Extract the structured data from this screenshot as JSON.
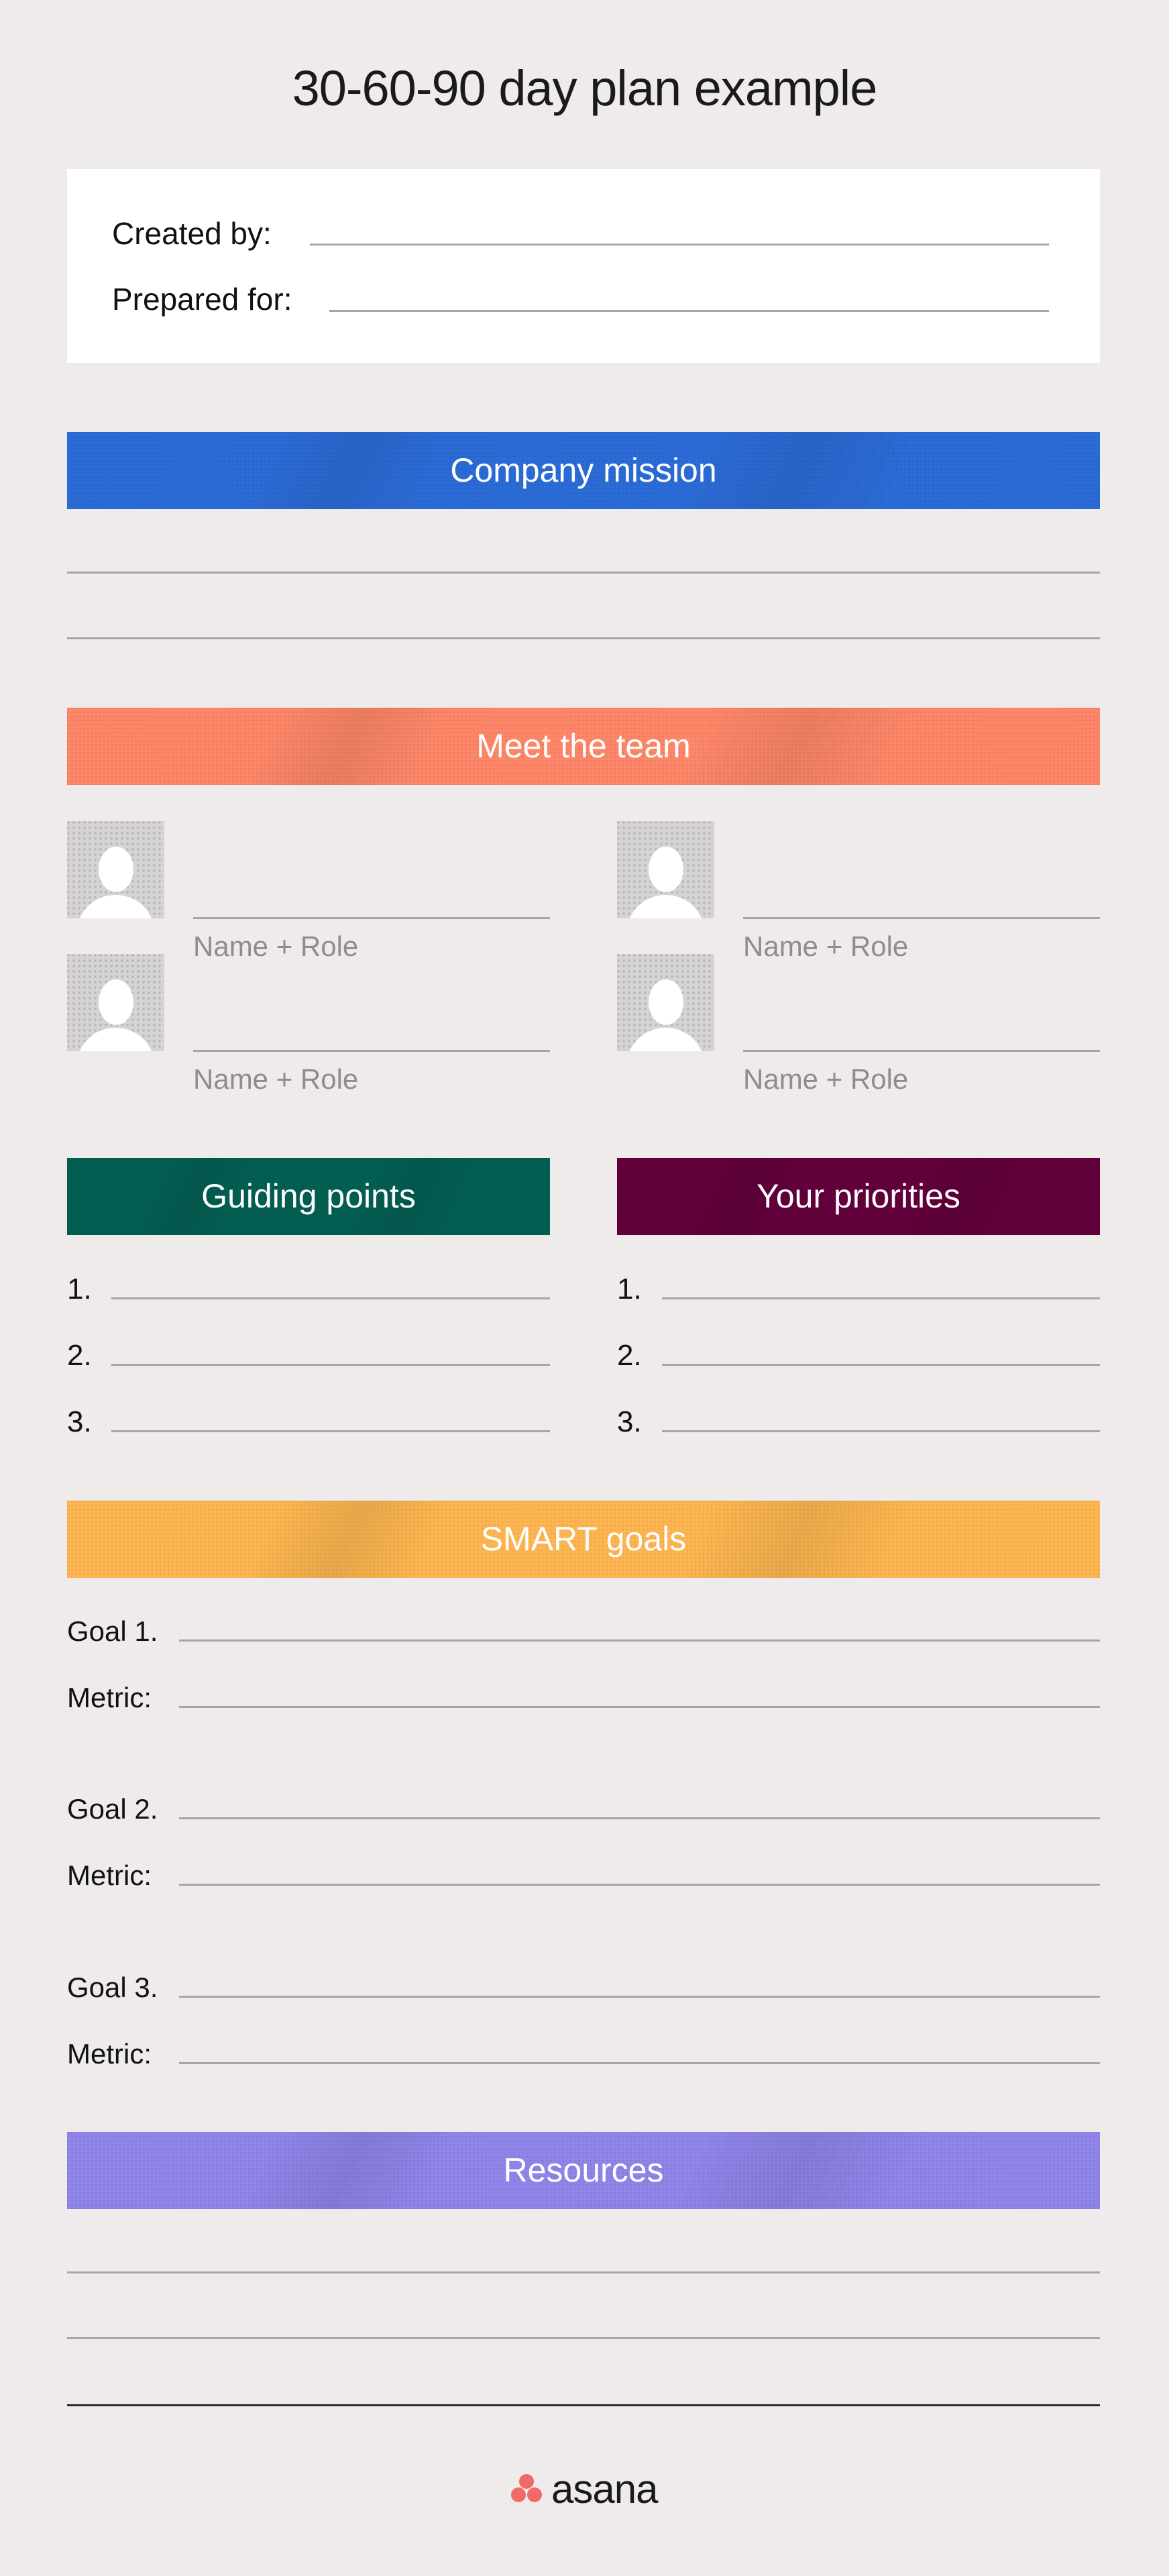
{
  "title": "30-60-90 day plan example",
  "header_card": {
    "created_by_label": "Created by:",
    "prepared_for_label": "Prepared for:"
  },
  "sections": {
    "company_mission": {
      "title": "Company mission",
      "color": "#2b6bd6"
    },
    "meet_the_team": {
      "title": "Meet the team",
      "color": "#fd8668",
      "members": [
        {
          "caption": "Name + Role"
        },
        {
          "caption": "Name + Role"
        },
        {
          "caption": "Name + Role"
        },
        {
          "caption": "Name + Role"
        }
      ]
    },
    "guiding_points": {
      "title": "Guiding points",
      "color": "#035e52",
      "items": [
        "1.",
        "2.",
        "3."
      ]
    },
    "your_priorities": {
      "title": "Your priorities",
      "color": "#62003b",
      "items": [
        "1.",
        "2.",
        "3."
      ]
    },
    "smart_goals": {
      "title": "SMART goals",
      "color": "#fcb550",
      "goals": [
        {
          "goal_label": "Goal 1.",
          "metric_label": "Metric:"
        },
        {
          "goal_label": "Goal 2.",
          "metric_label": "Metric:"
        },
        {
          "goal_label": "Goal 3.",
          "metric_label": "Metric:"
        }
      ]
    },
    "resources": {
      "title": "Resources",
      "color": "#8f84e8"
    }
  },
  "footer": {
    "brand": "asana",
    "brand_icon": "asana-dots-icon",
    "brand_color": "#f06a6a"
  }
}
